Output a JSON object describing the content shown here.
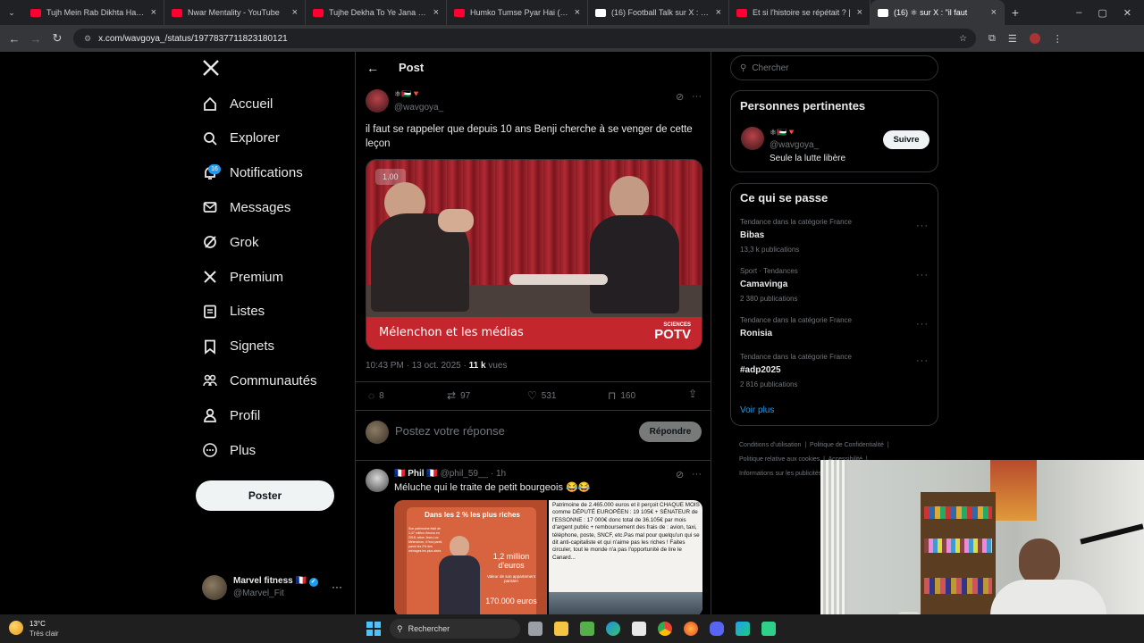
{
  "browser": {
    "tabs": [
      {
        "label": "Tujh Mein Rab Dikhta Hai Song",
        "color": "#ff0033"
      },
      {
        "label": "Nwar Mentality - YouTube",
        "color": "#ff0033"
      },
      {
        "label": "Tujhe Dekha To Ye Jana sanam",
        "color": "#ff0033"
      },
      {
        "label": "Humko Tumse Pyar Hai (2006)",
        "color": "#ff0033"
      },
      {
        "label": "(16) Football Talk sur X : \"Lamin",
        "color": "#ffffff"
      },
      {
        "label": "Et si l'histoire se répétait ? |",
        "color": "#ff0033"
      },
      {
        "label": "(16) ⚛ sur X : \"il faut",
        "color": "#ffffff"
      }
    ],
    "url": "x.com/wavgoya_/status/1977837711823180121"
  },
  "nav": {
    "items": [
      "Accueil",
      "Explorer",
      "Notifications",
      "Messages",
      "Grok",
      "Premium",
      "Listes",
      "Signets",
      "Communautés",
      "Profil",
      "Plus"
    ],
    "notif_badge": "16",
    "post_button": "Poster",
    "account_name": "Marvel fitness 🇫🇷",
    "account_handle": "@Marvel_Fit"
  },
  "post": {
    "header_title": "Post",
    "author_name": "⚛🇵🇸🔻",
    "author_handle": "@wavgoya_",
    "text": "il faut se rappeler que depuis 10 ans Benji cherche à se venger de cette leçon",
    "video_speed": "1.00",
    "video_caption": "Mélenchon et les médias",
    "video_logo_top": "SCIENCES",
    "video_logo_bottom": "POTV",
    "time": "10:43 PM · 13 oct. 2025 · ",
    "views_count": "11 k",
    "views_label": " vues",
    "replies": "8",
    "reposts": "97",
    "likes": "531",
    "bookmarks": "160",
    "reply_placeholder": "Postez votre réponse",
    "reply_button": "Répondre"
  },
  "reply": {
    "name": "🇫🇷 Phil 🇫🇷",
    "handle": "@phil_59__ · 1h",
    "text": "Méluche qui le traite de petit bourgeois 😂😂",
    "img1_title": "Dans les 2 % les plus riches",
    "img1_amount": "1,2 million d'euros",
    "img1_sub": "Valeur de son appartement parisien",
    "img1_bottom": "170.000 euros",
    "img1_body": "Son patrimoine était de 1,47 million d'euros en 2018, selon Jean-Luc Mélenchon, il l'est pareil, parmi les 2% des ménages les plus aisés",
    "img2_text": "Patrimoine de 2.465.000 euros et il perçoit CHAQUE MOIS comme DÉPUTÉ EUROPÉEN : 19 105€ + SÉNATEUR de l'ESSONNE : 17 000€ donc total de 36.105€ par mois d'argent public + remboursement des frais de : avion, taxi, téléphone, poste, SNCF, etc.Pas mal pour quelqu'un qui se dit anti-capitaliste et qui n'aime pas les riches ! Faites circuler, tout le monde n'a pas l'opportunité de lire le Canard..."
  },
  "right": {
    "search_placeholder": "Chercher",
    "relevant_title": "Personnes pertinentes",
    "relevant_name": "⚛🇵🇸🔻",
    "relevant_handle": "@wavgoya_",
    "relevant_bio": "Seule la lutte libère",
    "follow_button": "Suivre",
    "trends_title": "Ce qui se passe",
    "trends": [
      {
        "cat": "Tendance dans la catégorie France",
        "name": "Bibas",
        "count": "13,3 k publications"
      },
      {
        "cat": "Sport · Tendances",
        "name": "Camavinga",
        "count": "2 380 publications"
      },
      {
        "cat": "Tendance dans la catégorie France",
        "name": "Ronisia",
        "count": ""
      },
      {
        "cat": "Tendance dans la catégorie France",
        "name": "#adp2025",
        "count": "2 816 publications"
      }
    ],
    "see_more": "Voir plus",
    "footer1": "Conditions d'utilisation",
    "footer2": "Politique de Confidentialité",
    "footer3": "Politique relative aux cookies",
    "footer4": "Accessibilité",
    "footer5": "Informations sur les publicités"
  },
  "taskbar": {
    "temp": "13°C",
    "weather": "Très clair",
    "search": "Rechercher"
  },
  "colors": {
    "bg": "#000000",
    "border": "#2f3336",
    "text": "#e7e9ea",
    "muted": "#71767b",
    "accent": "#1d9bf0"
  }
}
